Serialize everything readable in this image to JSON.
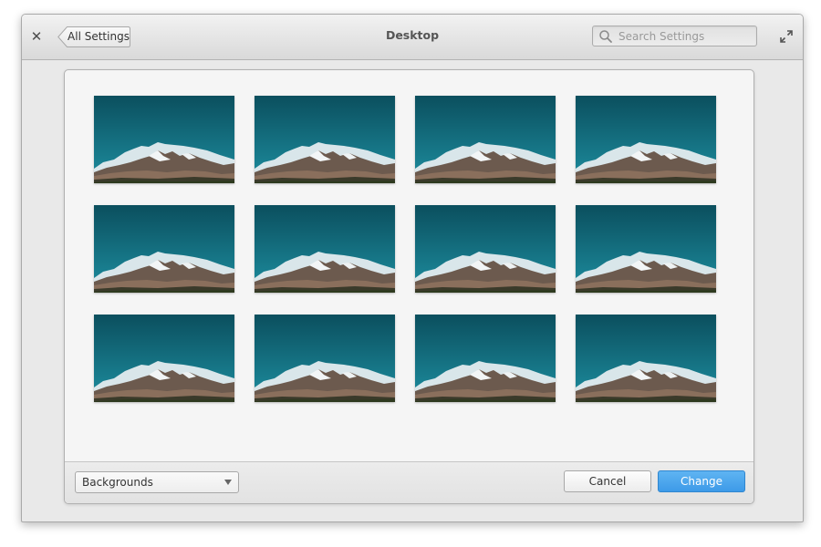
{
  "window": {
    "title": "Desktop",
    "back_label": "All Settings",
    "search_placeholder": "Search Settings"
  },
  "icons": {
    "close": "close-icon",
    "back": "back-arrow-icon",
    "search": "search-icon",
    "maximize": "maximize-icon"
  },
  "wallpapers": [
    {
      "name": "mountain-wallpaper"
    },
    {
      "name": "mountain-wallpaper"
    },
    {
      "name": "mountain-wallpaper"
    },
    {
      "name": "mountain-wallpaper"
    },
    {
      "name": "mountain-wallpaper"
    },
    {
      "name": "mountain-wallpaper"
    },
    {
      "name": "mountain-wallpaper"
    },
    {
      "name": "mountain-wallpaper"
    },
    {
      "name": "mountain-wallpaper"
    },
    {
      "name": "mountain-wallpaper"
    },
    {
      "name": "mountain-wallpaper"
    },
    {
      "name": "mountain-wallpaper"
    }
  ],
  "footer": {
    "source_selected": "Backgrounds",
    "cancel_label": "Cancel",
    "change_label": "Change"
  },
  "colors": {
    "accent": "#3d9ae8",
    "sky_top": "#0b4f5e",
    "sky_bottom": "#1d8ea0"
  }
}
